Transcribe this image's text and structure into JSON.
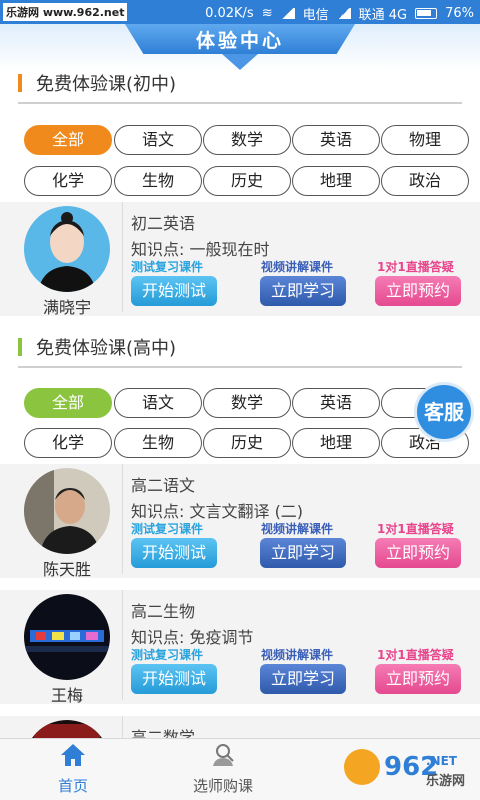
{
  "status_bar": {
    "watermark": "乐游网 www.962.net",
    "speed": "0.02K/s",
    "carrier1": "电信",
    "carrier2": "联通 4G",
    "battery": "76%"
  },
  "header": {
    "title": "体验中心"
  },
  "section_junior": {
    "title": "免费体验课(初中)",
    "filters": [
      "全部",
      "语文",
      "数学",
      "英语",
      "物理",
      "化学",
      "生物",
      "历史",
      "地理",
      "政治"
    ],
    "active_filter": "全部"
  },
  "section_senior": {
    "title": "免费体验课(高中)",
    "filters": [
      "全部",
      "语文",
      "数学",
      "英语",
      "物",
      "化学",
      "生物",
      "历史",
      "地理",
      "政治"
    ],
    "active_filter": "全部"
  },
  "tags": {
    "review": "测试复习课件",
    "video": "视频讲解课件",
    "live": "1对1直播答疑"
  },
  "buttons": {
    "test": "开始测试",
    "learn": "立即学习",
    "book": "立即预约"
  },
  "cards": [
    {
      "course": "初二英语",
      "knowledge": "知识点: 一般现在时",
      "teacher": "满晓宇"
    },
    {
      "course": "高二语文",
      "knowledge": "知识点: 文言文翻译 (二)",
      "teacher": "陈天胜"
    },
    {
      "course": "高二生物",
      "knowledge": "知识点: 免疫调节",
      "teacher": "王梅"
    },
    {
      "course": "高二数学",
      "knowledge": "",
      "teacher": ""
    }
  ],
  "floating": {
    "service": "客服"
  },
  "bottom_nav": {
    "home": "首页",
    "teacher": "选师购课",
    "brand": "962",
    "brand_sub": "乐游网",
    "brand_domain": ".NET"
  },
  "colors": {
    "accent_blue": "#2f7fd6",
    "junior_active": "#f08a1c",
    "senior_active": "#8bc53f"
  }
}
